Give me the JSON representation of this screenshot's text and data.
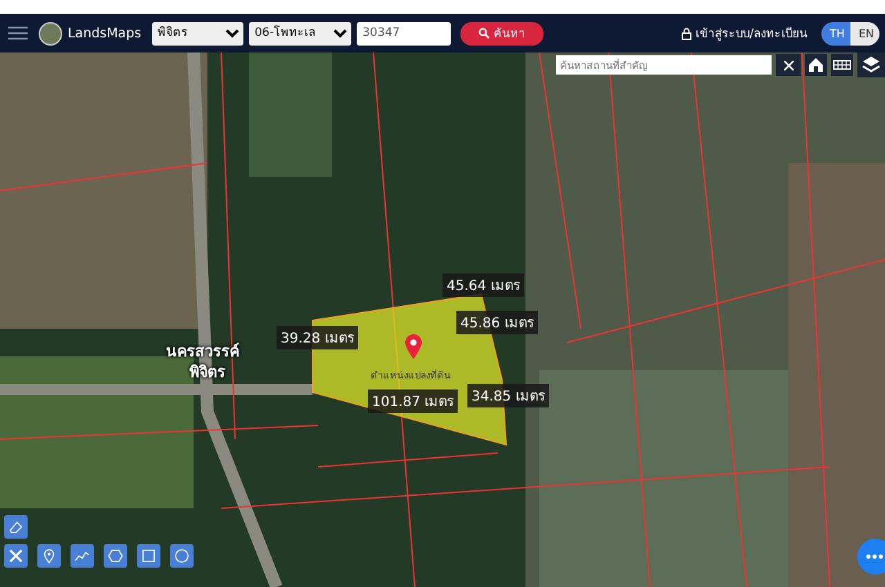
{
  "navbar": {
    "logo": "LandsMaps",
    "province": "พิจิตร",
    "district": "06-โพทะเล",
    "parcel_number": "30347",
    "search_button": "ค้นหา",
    "login": "เข้าสู่ระบบ/ลงทะเบียน",
    "languages": [
      {
        "label": "TH",
        "selected": true
      },
      {
        "label": "EN",
        "selected": false
      }
    ]
  },
  "map": {
    "place_search": {
      "placeholder": "ค้นหาสถานที่สำคัญ"
    },
    "road_labels": [
      "นครสวรรค์",
      "พิจิตร"
    ],
    "pin_label": "ตำแหน่งแปลงที่ดิน",
    "measurements": [
      "45.64 เมตร",
      "45.86 เมตร",
      "39.28 เมตร",
      "101.87 เมตร",
      "34.85 เมตร"
    ]
  }
}
